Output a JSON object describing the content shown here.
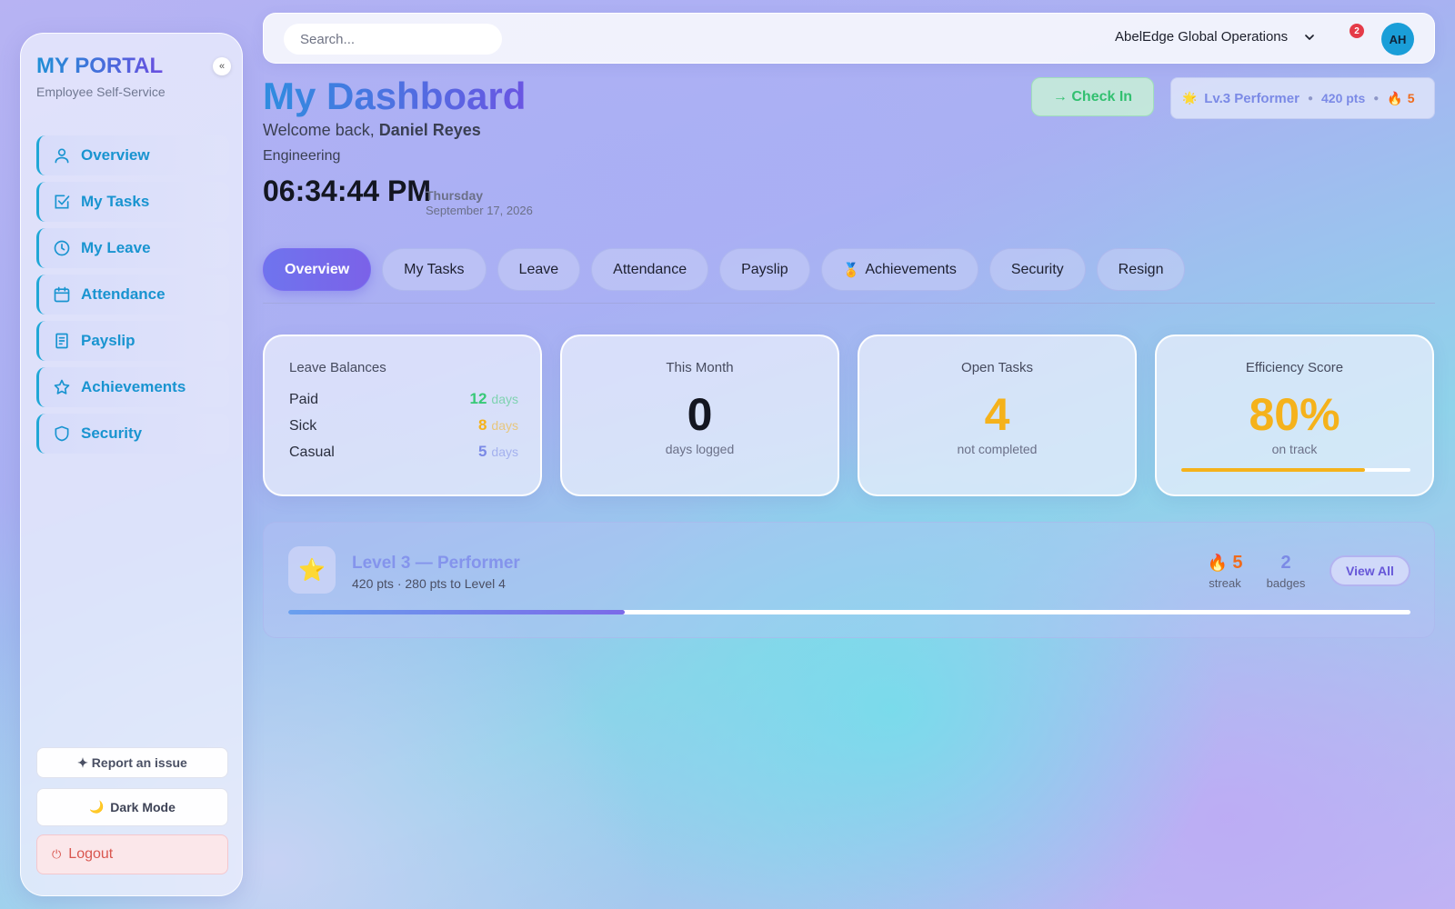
{
  "sidebar": {
    "brand": "MY PORTAL",
    "subtitle": "Employee Self-Service",
    "collapse_icon": "«",
    "items": [
      {
        "label": "Overview",
        "icon": "user-icon"
      },
      {
        "label": "My Tasks",
        "icon": "checkbox-icon"
      },
      {
        "label": "My Leave",
        "icon": "clock-icon"
      },
      {
        "label": "Attendance",
        "icon": "calendar-icon"
      },
      {
        "label": "Payslip",
        "icon": "document-icon"
      },
      {
        "label": "Achievements",
        "icon": "star-icon"
      },
      {
        "label": "Security",
        "icon": "shield-icon"
      }
    ],
    "report_label": "✦ Report an issue",
    "dark_mode_label": "Dark Mode",
    "logout_label": "Logout"
  },
  "topbar": {
    "search_placeholder": "Search...",
    "org_name": "AbelEdge Global Operations",
    "notification_count": "2",
    "avatar_initials": "AH"
  },
  "header": {
    "title": "My Dashboard",
    "welcome_prefix": "Welcome back,",
    "user_name": "Daniel Reyes",
    "department": "Engineering",
    "clock": "06:34:44 PM",
    "weekday": "Thursday",
    "date": "September 17, 2026",
    "checkin_label": "→ Check In",
    "level_label": "Lv.3 Performer",
    "points_label": "420 pts",
    "streak_count": "5"
  },
  "tabs": [
    {
      "label": "Overview",
      "active": true
    },
    {
      "label": "My Tasks"
    },
    {
      "label": "Leave"
    },
    {
      "label": "Attendance"
    },
    {
      "label": "Payslip"
    },
    {
      "label": "Achievements"
    },
    {
      "label": "Security"
    },
    {
      "label": "Resign"
    }
  ],
  "cards": {
    "leave": {
      "title": "Leave Balances",
      "rows": [
        {
          "name": "Paid",
          "value": "12",
          "unit": "days",
          "color": "#37c977"
        },
        {
          "name": "Sick",
          "value": "8",
          "unit": "days",
          "color": "#f5b21b"
        },
        {
          "name": "Casual",
          "value": "5",
          "unit": "days",
          "color": "#7b8ae6"
        }
      ]
    },
    "month": {
      "title": "This Month",
      "value": "0",
      "sub": "days logged",
      "color": "#131621"
    },
    "tasks": {
      "title": "Open Tasks",
      "value": "4",
      "sub": "not completed",
      "color": "#f5b21b"
    },
    "efficiency": {
      "title": "Efficiency Score",
      "value": "80%",
      "sub": "on track",
      "color": "#f5b21b",
      "progress": 0.8
    }
  },
  "level_card": {
    "title": "Level 3 — Performer",
    "subtitle": "420 pts · 280 pts to Level 4",
    "streak_value": "5",
    "streak_label": "streak",
    "badges_value": "2",
    "badges_label": "badges",
    "view_all_label": "View All",
    "progress": 0.3
  },
  "colors": {
    "accent": "#1994d0",
    "brand_gradient_start": "#1f8fd6",
    "brand_gradient_end": "#6a4fe0",
    "active_tab": "#6f74ee",
    "success": "#37c977",
    "warning": "#f5b21b",
    "danger": "#d9564f"
  }
}
